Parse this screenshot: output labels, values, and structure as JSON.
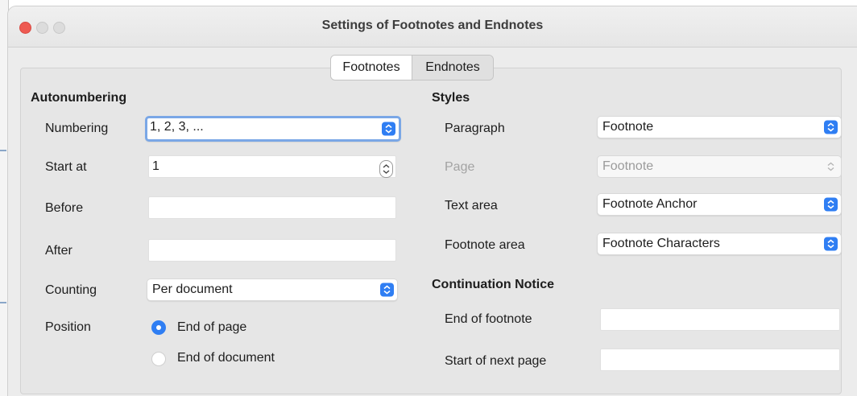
{
  "window": {
    "title": "Settings of Footnotes and Endnotes"
  },
  "tabs": [
    {
      "label": "Footnotes",
      "active": true
    },
    {
      "label": "Endnotes",
      "active": false
    }
  ],
  "autonumbering": {
    "heading": "Autonumbering",
    "numbering": {
      "label": "Numbering",
      "value": "1, 2, 3, ..."
    },
    "start_at": {
      "label": "Start at",
      "value": "1"
    },
    "before": {
      "label": "Before",
      "value": ""
    },
    "after": {
      "label": "After",
      "value": ""
    },
    "counting": {
      "label": "Counting",
      "value": "Per document"
    },
    "position": {
      "label": "Position",
      "options": [
        {
          "label": "End of page",
          "selected": true
        },
        {
          "label": "End of document",
          "selected": false
        }
      ]
    }
  },
  "styles": {
    "heading": "Styles",
    "paragraph": {
      "label": "Paragraph",
      "value": "Footnote"
    },
    "page": {
      "label": "Page",
      "value": "Footnote",
      "disabled": true
    },
    "text_area": {
      "label": "Text area",
      "value": "Footnote Anchor"
    },
    "footnote_area": {
      "label": "Footnote area",
      "value": "Footnote Characters"
    }
  },
  "continuation": {
    "heading": "Continuation Notice",
    "end_of_footnote": {
      "label": "End of footnote",
      "value": ""
    },
    "start_of_next_page": {
      "label": "Start of next page",
      "value": ""
    }
  },
  "colors": {
    "accent": "#2f7ef3",
    "close": "#ee5a52",
    "focus_ring": "#7aa7e6"
  }
}
